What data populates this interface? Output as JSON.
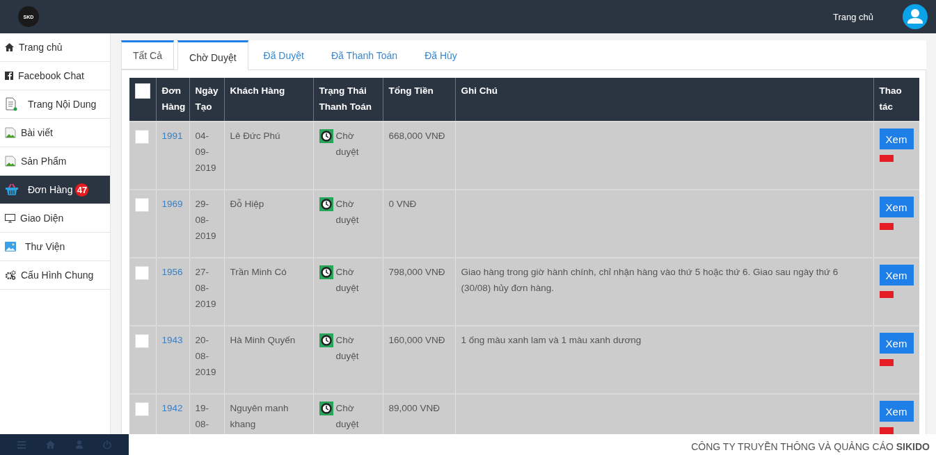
{
  "header": {
    "logo": "SKD",
    "home_link": "Trang chủ"
  },
  "sidebar": {
    "items": [
      {
        "label": "Trang chủ",
        "selected": false
      },
      {
        "label": "Facebook Chat",
        "selected": false
      },
      {
        "label": "Trang Nội Dung",
        "selected": false
      },
      {
        "label": "Bài viết",
        "selected": false
      },
      {
        "label": "Sản Phẩm",
        "selected": false
      },
      {
        "label": "Đơn Hàng",
        "selected": true,
        "badge": "47"
      },
      {
        "label": "Giao Diện",
        "selected": false
      },
      {
        "label": "Thư Viện",
        "selected": false
      },
      {
        "label": "Cấu Hình Chung",
        "selected": false
      }
    ]
  },
  "tabs": [
    {
      "label": "Tất Cả",
      "selected": false,
      "outlined": true
    },
    {
      "label": "Chờ Duyệt",
      "selected": true,
      "outlined": true
    },
    {
      "label": "Đã Duyệt",
      "selected": false,
      "outlined": false
    },
    {
      "label": "Đã Thanh Toán",
      "selected": false,
      "outlined": false
    },
    {
      "label": "Đã Hủy",
      "selected": false,
      "outlined": false
    }
  ],
  "table": {
    "select_all_checked": false,
    "columns": [
      "Đơn Hàng",
      "Ngày Tạo",
      "Khách Hàng",
      "Trạng Thái Thanh Toán",
      "Tổng Tiền",
      "Ghi Chú",
      "Thao tác"
    ],
    "rows": [
      {
        "checked": false,
        "order": "1991",
        "date": "04-09-2019",
        "customer": "Lê Đức Phú",
        "status": "Chờ duyệt",
        "total": "668,000 VNĐ",
        "note": "",
        "action": "Xem"
      },
      {
        "checked": false,
        "order": "1969",
        "date": "29-08-2019",
        "customer": "Đỗ Hiệp",
        "status": "Chờ duyệt",
        "total": "0 VNĐ",
        "note": "",
        "action": "Xem"
      },
      {
        "checked": false,
        "order": "1956",
        "date": "27-08-2019",
        "customer": "Trần Minh Có",
        "status": "Chờ duyệt",
        "total": "798,000 VNĐ",
        "note": "Giao hàng trong giờ hành chính, chỉ nhận hàng vào thứ 5 hoặc thứ 6. Giao sau ngày thứ 6 (30/08) hủy đơn hàng.",
        "action": "Xem"
      },
      {
        "checked": false,
        "order": "1943",
        "date": "20-08-2019",
        "customer": "Hà Minh Quyến",
        "status": "Chờ duyệt",
        "total": "160,000 VNĐ",
        "note": "1 ống màu xanh lam và 1 màu xanh dương",
        "action": "Xem"
      },
      {
        "checked": false,
        "order": "1942",
        "date": "19-08-",
        "customer": "Nguyên manh khang",
        "status": "Chờ duyệt",
        "total": "89,000 VNĐ",
        "note": "",
        "action": "Xem"
      }
    ]
  },
  "footer": {
    "text": "CÔNG TY TRUYỀN THÔNG VÀ QUẢNG CÁO **SIKIDO**"
  }
}
